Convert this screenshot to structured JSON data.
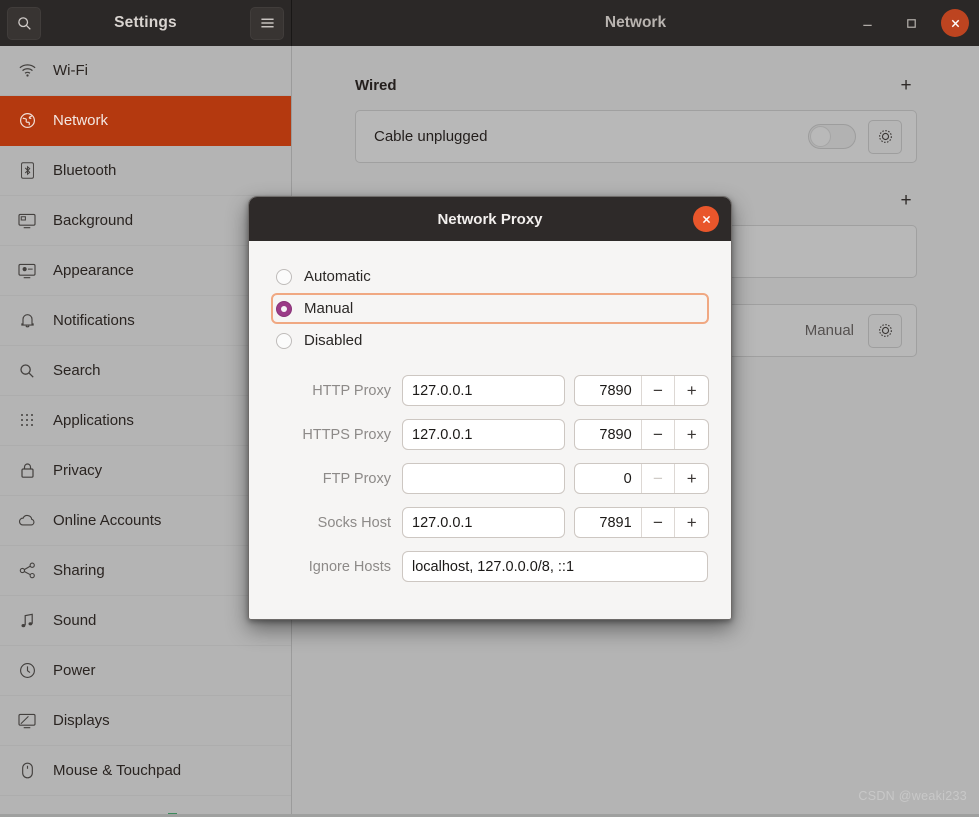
{
  "header": {
    "settings_title": "Settings",
    "window_title": "Network",
    "search_icon": "search-icon",
    "menu_icon": "hamburger-menu-icon",
    "minimize_label": "–",
    "maximize_label": "□",
    "close_label": "×",
    "close_color": "#bd4420"
  },
  "sidebar": {
    "items": [
      {
        "label": "Wi-Fi",
        "icon": "wifi-icon",
        "selected": false
      },
      {
        "label": "Network",
        "icon": "globe-icon",
        "selected": true
      },
      {
        "label": "Bluetooth",
        "icon": "bluetooth-icon",
        "selected": false
      },
      {
        "label": "Background",
        "icon": "background-monitor-icon",
        "selected": false
      },
      {
        "label": "Appearance",
        "icon": "appearance-monitor-icon",
        "selected": false
      },
      {
        "label": "Notifications",
        "icon": "bell-icon",
        "selected": false
      },
      {
        "label": "Search",
        "icon": "search-icon",
        "selected": false
      },
      {
        "label": "Applications",
        "icon": "grid-dots-icon",
        "selected": false
      },
      {
        "label": "Privacy",
        "icon": "lock-icon",
        "selected": false
      },
      {
        "label": "Online Accounts",
        "icon": "cloud-icon",
        "selected": false
      },
      {
        "label": "Sharing",
        "icon": "share-nodes-icon",
        "selected": false
      },
      {
        "label": "Sound",
        "icon": "music-note-icon",
        "selected": false
      },
      {
        "label": "Power",
        "icon": "power-icon",
        "selected": false
      },
      {
        "label": "Displays",
        "icon": "displays-icon",
        "selected": false
      },
      {
        "label": "Mouse & Touchpad",
        "icon": "mouse-icon",
        "selected": false
      }
    ],
    "selected_color": "#b4390f"
  },
  "main": {
    "wired": {
      "section_title": "Wired",
      "add_label": "+",
      "status": "Cable unplugged",
      "settings_icon": "gear-icon"
    },
    "section2": {
      "add_label": "+"
    },
    "proxy_row": {
      "value": "Manual",
      "settings_icon": "gear-icon"
    }
  },
  "dialog": {
    "title": "Network Proxy",
    "close_label": "×",
    "close_color": "#e9562b",
    "focus_color": "#f0a882",
    "radio_checked_color": "#9b3b87",
    "options": [
      {
        "label": "Automatic",
        "checked": false,
        "focused": false
      },
      {
        "label": "Manual",
        "checked": true,
        "focused": true
      },
      {
        "label": "Disabled",
        "checked": false,
        "focused": false
      }
    ],
    "fields": [
      {
        "label": "HTTP Proxy",
        "host": "127.0.0.1",
        "host_placeholder": "",
        "port": "7890",
        "minus": "−",
        "plus": "+",
        "minus_disabled": false
      },
      {
        "label": "HTTPS Proxy",
        "host": "127.0.0.1",
        "host_placeholder": "",
        "port": "7890",
        "minus": "−",
        "plus": "+",
        "minus_disabled": false
      },
      {
        "label": "FTP Proxy",
        "host": "",
        "host_placeholder": "",
        "port": "0",
        "minus": "−",
        "plus": "+",
        "minus_disabled": true
      },
      {
        "label": "Socks Host",
        "host": "127.0.0.1",
        "host_placeholder": "",
        "port": "7891",
        "minus": "−",
        "plus": "+",
        "minus_disabled": false
      }
    ],
    "ignore": {
      "label": "Ignore Hosts",
      "value": "localhost, 127.0.0.0/8, ::1",
      "placeholder": ""
    }
  },
  "watermark": {
    "text": "CSDN @weaki233"
  }
}
